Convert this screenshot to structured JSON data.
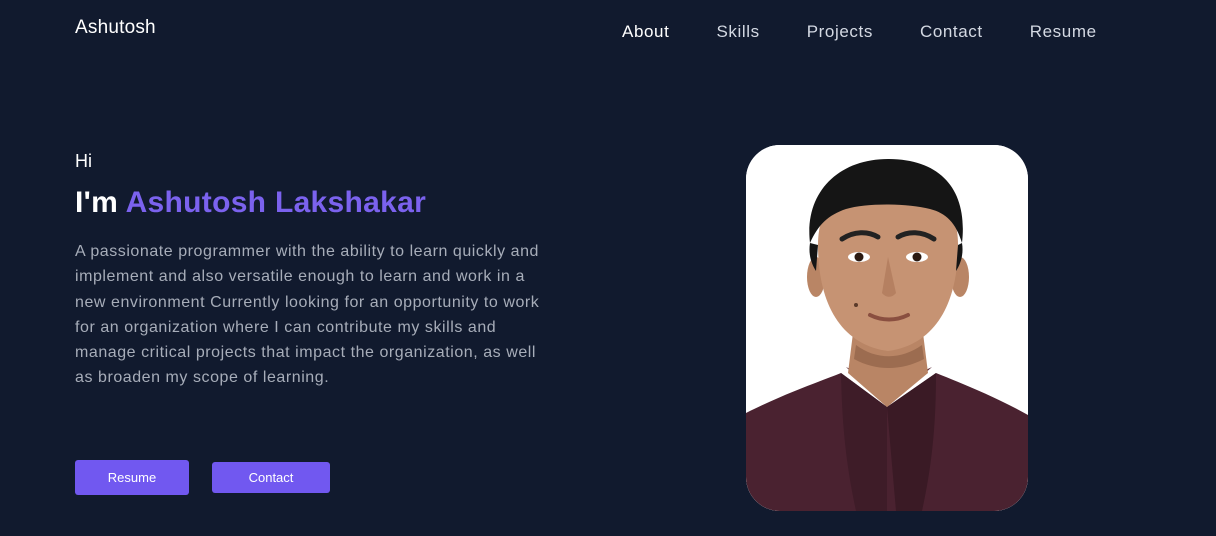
{
  "header": {
    "brand": "Ashutosh",
    "nav": [
      "About",
      "Skills",
      "Projects",
      "Contact",
      "Resume"
    ]
  },
  "hero": {
    "greeting": "Hi",
    "headline_prefix": "I'm ",
    "headline_name": "Ashutosh Lakshakar",
    "bio_lines": [
      "A passionate programmer with the ability to learn quickly and",
      "implement and also versatile enough to learn and work in a",
      "new environment Currently looking for an opportunity to work",
      "for an organization where I can contribute my skills and",
      "manage critical projects that impact the organization, as well",
      "as broaden my scope of learning."
    ],
    "buttons": {
      "resume": "Resume",
      "contact": "Contact"
    }
  },
  "colors": {
    "background": "#111a2e",
    "accent": "#7b62ee",
    "button": "#7158f0",
    "body_text": "#a7adb9"
  }
}
